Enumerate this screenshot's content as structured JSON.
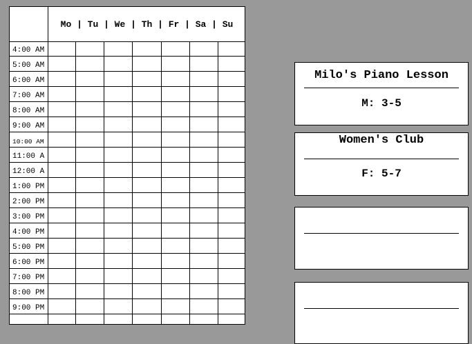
{
  "schedule": {
    "day_header": "Mo | Tu | We | Th | Fr | Sa | Su",
    "times": [
      "4:00 AM",
      "5:00 AM",
      "6:00 AM",
      "7:00 AM",
      "8:00 AM",
      "9:00 AM",
      "10:00 AM",
      "11:00 A",
      "12:00 A",
      "1:00 PM",
      "2:00 PM",
      "3:00 PM",
      "4:00 PM",
      "5:00 PM",
      "6:00 PM",
      "7:00 PM",
      "8:00 PM",
      "9:00 PM",
      ""
    ]
  },
  "cards": [
    {
      "title": "Milo's Piano Lesson",
      "detail": "M: 3-5"
    },
    {
      "title": "Women's Club",
      "detail": "F: 5-7"
    },
    {
      "title": "",
      "detail": ""
    },
    {
      "title": "",
      "detail": ""
    }
  ]
}
